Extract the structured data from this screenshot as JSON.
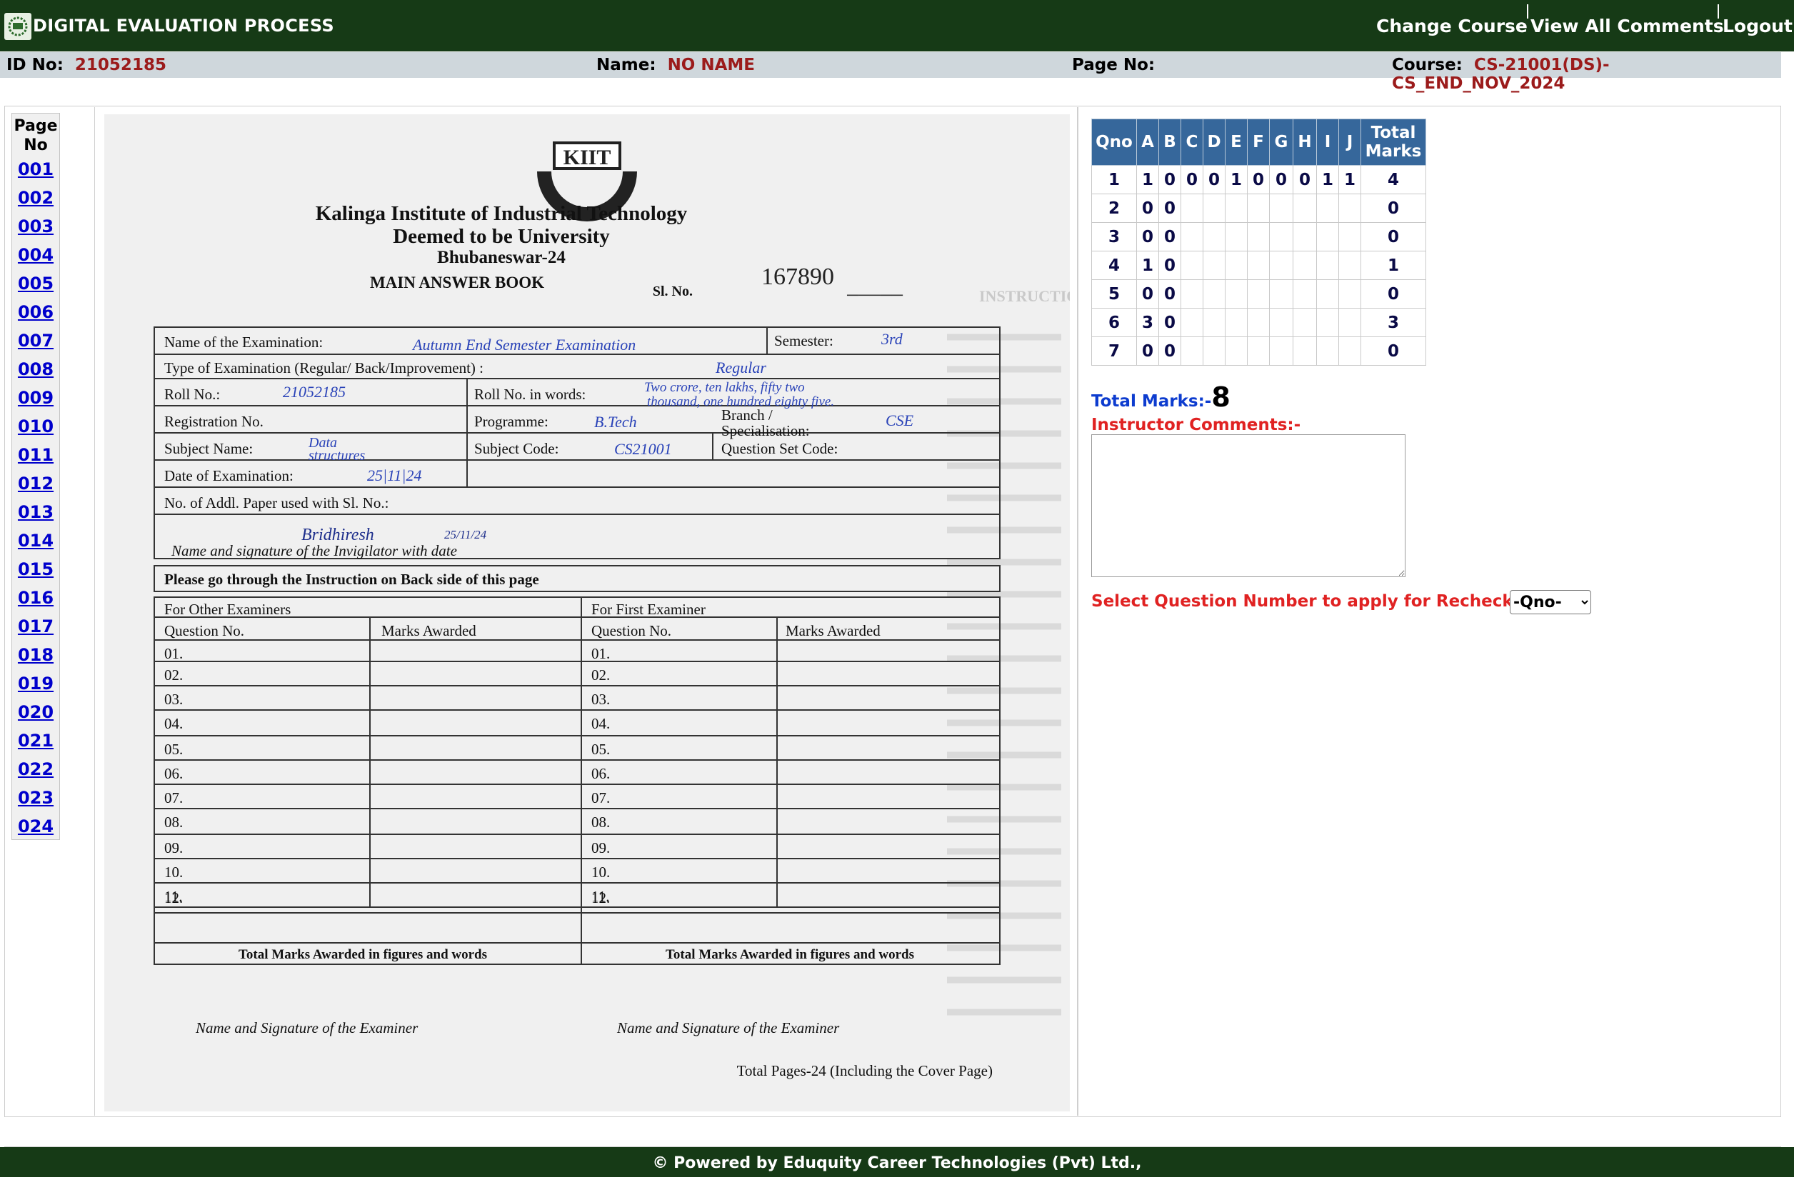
{
  "header": {
    "app_title": "DIGITAL EVALUATION PROCESS",
    "links": {
      "change_course": "Change Course",
      "view_all_comments": "View All Comments",
      "logout": "Logout"
    }
  },
  "info": {
    "id_label": "ID No:",
    "id_value": "21052185",
    "name_label": "Name:",
    "name_value": "NO NAME",
    "page_label": "Page No:",
    "page_value": "",
    "course_label": "Course:",
    "course_value": "CS-21001(DS)-CS_END_NOV_2024"
  },
  "pagenav": {
    "heading_line1": "Page",
    "heading_line2": "No",
    "pages": [
      "001",
      "002",
      "003",
      "004",
      "005",
      "006",
      "007",
      "008",
      "009",
      "010",
      "011",
      "012",
      "013",
      "014",
      "015",
      "016",
      "017",
      "018",
      "019",
      "020",
      "021",
      "022",
      "023",
      "024"
    ]
  },
  "document": {
    "logo_text": "KIIT",
    "institute": "Kalinga Institute of Industrial Technology",
    "subtitle": "Deemed to be University",
    "city": "Bhubaneswar-24",
    "book_title": "MAIN ANSWER BOOK",
    "serial_label": "Sl. No.",
    "serial_no": "167890",
    "exam_name_label": "Name of the Examination:",
    "exam_name_value": "Autumn End Semester Examination",
    "semester_label": "Semester:",
    "semester_value": "3rd",
    "exam_type_label": "Type of Examination (Regular/ Back/Improvement) :",
    "exam_type_value": "Regular",
    "roll_label": "Roll No.:",
    "roll_value": "21052185",
    "roll_words_label": "Roll No. in words:",
    "roll_words_line1": "Two crore, ten lakhs, fifty two",
    "roll_words_line2": "thousand, one hundred eighty five.",
    "registration_label": "Registration No.",
    "programme_label": "Programme:",
    "programme_value": "B.Tech",
    "branch_label1": "Branch /",
    "branch_label2": "Specialisation:",
    "branch_value": "CSE",
    "subject_label": "Subject Name:",
    "subject_value1": "Data",
    "subject_value2": "structures",
    "subject_code_label": "Subject  Code:",
    "subject_code_value": "CS21001",
    "question_set_label": "Question Set Code:",
    "date_label": "Date of Examination:",
    "date_value": "25|11|24",
    "addl_paper_label": "No. of Addl. Paper used with Sl. No.:",
    "invigilator_sig": "Bridhiresh",
    "invigilator_date": "25/11/24",
    "invigilator_label": "Name and signature of the Invigilator with date",
    "instruction_notice": "Please go through the Instruction on Back side of this page",
    "other_examiners": "For Other Examiners",
    "first_examiner": "For First Examiner",
    "question_no": "Question No.",
    "marks_awarded": "Marks Awarded",
    "questions": [
      "01.",
      "02.",
      "03.",
      "04.",
      "05.",
      "06.",
      "07.",
      "08.",
      "09.",
      "10.",
      "11.",
      "12."
    ],
    "total_marks_words": "Total Marks Awarded in figures and words",
    "examiner_sig_label": "Name and Signature of the Examiner",
    "total_pages": "Total Pages-24 (Including the Cover Page)",
    "bleed_heading": "INSTRUCTIONS FOR THE CANDIDATES"
  },
  "marks_table": {
    "headers": [
      "Qno",
      "A",
      "B",
      "C",
      "D",
      "E",
      "F",
      "G",
      "H",
      "I",
      "J",
      "Total Marks"
    ],
    "rows": [
      [
        "1",
        "1",
        "0",
        "0",
        "0",
        "1",
        "0",
        "0",
        "0",
        "1",
        "1",
        "4"
      ],
      [
        "2",
        "0",
        "0",
        "",
        "",
        "",
        "",
        "",
        "",
        "",
        "",
        "0"
      ],
      [
        "3",
        "0",
        "0",
        "",
        "",
        "",
        "",
        "",
        "",
        "",
        "",
        "0"
      ],
      [
        "4",
        "1",
        "0",
        "",
        "",
        "",
        "",
        "",
        "",
        "",
        "",
        "1"
      ],
      [
        "5",
        "0",
        "0",
        "",
        "",
        "",
        "",
        "",
        "",
        "",
        "",
        "0"
      ],
      [
        "6",
        "3",
        "0",
        "",
        "",
        "",
        "",
        "",
        "",
        "",
        "",
        "3"
      ],
      [
        "7",
        "0",
        "0",
        "",
        "",
        "",
        "",
        "",
        "",
        "",
        "",
        "0"
      ]
    ]
  },
  "summary": {
    "total_label": "Total Marks:-",
    "total_value": "8",
    "comments_label": "Instructor Comments:-",
    "recheck_label": "Select Question Number to apply for Recheck:-",
    "recheck_option": "-Qno-"
  },
  "footer": {
    "text": "© Powered by Eduquity Career Technologies (Pvt) Ltd.,"
  }
}
